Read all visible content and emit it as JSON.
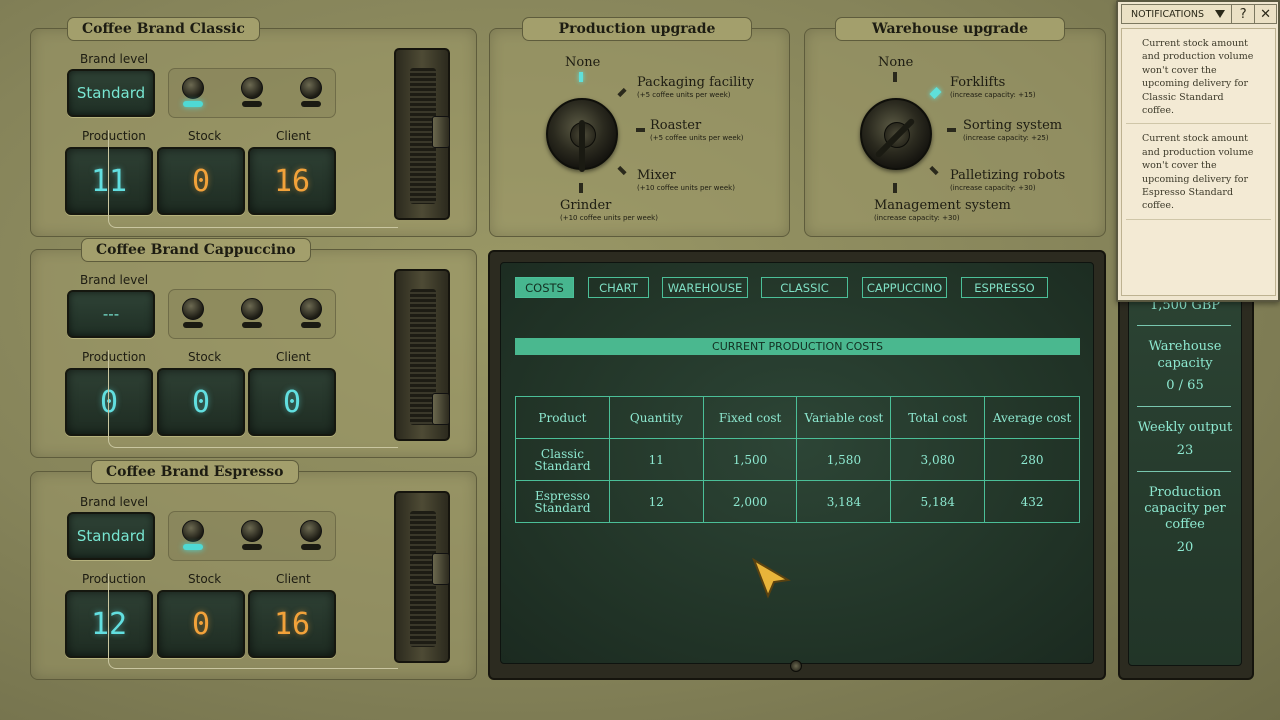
{
  "brands": [
    {
      "title": "Coffee Brand Classic",
      "level_label": "Brand level",
      "level_value": "Standard",
      "toggles_on": [
        true,
        false,
        false
      ],
      "production_label": "Production",
      "stock_label": "Stock",
      "client_label": "Client",
      "production": "11",
      "stock": "0",
      "client": "16",
      "slider_level": 0.55
    },
    {
      "title": "Coffee Brand Cappuccino",
      "level_label": "Brand level",
      "level_value": "---",
      "toggles_on": [
        false,
        false,
        false
      ],
      "production_label": "Production",
      "stock_label": "Stock",
      "client_label": "Client",
      "production": "0",
      "stock": "0",
      "client": "0",
      "slider_level": 0.85
    },
    {
      "title": "Coffee Brand Espresso",
      "level_label": "Brand level",
      "level_value": "Standard",
      "toggles_on": [
        true,
        false,
        false
      ],
      "production_label": "Production",
      "stock_label": "Stock",
      "client_label": "Client",
      "production": "12",
      "stock": "0",
      "client": "16",
      "slider_level": 0.5
    }
  ],
  "production_upgrade": {
    "title": "Production upgrade",
    "none": "None",
    "options": [
      {
        "name": "Packaging facility",
        "sub": "(+5 coffee units per week)"
      },
      {
        "name": "Roaster",
        "sub": "(+5 coffee units per week)"
      },
      {
        "name": "Mixer",
        "sub": "(+10 coffee units per week)"
      },
      {
        "name": "Grinder",
        "sub": "(+10 coffee units per week)"
      }
    ]
  },
  "warehouse_upgrade": {
    "title": "Warehouse upgrade",
    "none": "None",
    "options": [
      {
        "name": "Forklifts",
        "sub": "(increase capacity: +15)"
      },
      {
        "name": "Sorting system",
        "sub": "(increase capacity: +25)"
      },
      {
        "name": "Palletizing robots",
        "sub": "(increase capacity: +30)"
      },
      {
        "name": "Management system",
        "sub": "(increase capacity: +30)"
      }
    ]
  },
  "tabs": [
    "COSTS",
    "CHART",
    "WAREHOUSE",
    "CLASSIC",
    "CAPPUCCINO",
    "ESPRESSO"
  ],
  "active_tab": "COSTS",
  "costs": {
    "banner": "CURRENT PRODUCTION COSTS",
    "headers": [
      "Product",
      "Quantity",
      "Fixed cost",
      "Variable cost",
      "Total cost",
      "Average cost"
    ],
    "rows": [
      {
        "product": [
          "Classic",
          "Standard"
        ],
        "quantity": "11",
        "fixed": "1,500",
        "variable": "1,580",
        "total": "3,080",
        "average": "280"
      },
      {
        "product": [
          "Espresso",
          "Standard"
        ],
        "quantity": "12",
        "fixed": "2,000",
        "variable": "3,184",
        "total": "5,184",
        "average": "432"
      }
    ]
  },
  "stats": {
    "partial_top": "1,500 GBP",
    "warehouse_label": [
      "Warehouse",
      "capacity"
    ],
    "warehouse_value": "0 / 65",
    "weekly_label": "Weekly output",
    "weekly_value": "23",
    "capacity_label": [
      "Production",
      "capacity per",
      "coffee"
    ],
    "capacity_value": "20"
  },
  "notifications": {
    "title": "NOTIFICATIONS",
    "dropdown_icon": "chevron-down-icon",
    "help_label": "?",
    "close_label": "✕",
    "items": [
      "Current stock amount and production volume won't cover the upcoming delivery for Classic Standard coffee.",
      "Current stock amount and production volume won't cover the upcoming delivery for Espresso Standard coffee."
    ]
  },
  "colors": {
    "screen_text": "#8de8d0",
    "tab_accent": "#4ab88f",
    "digit_cyan": "#62dfe0",
    "digit_amber": "#f2a23a"
  }
}
